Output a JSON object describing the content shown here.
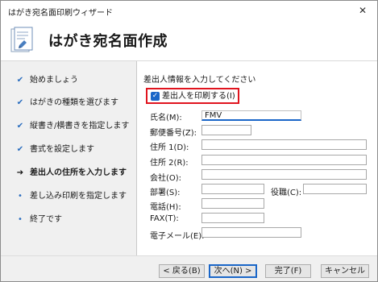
{
  "window": {
    "title": "はがき宛名面印刷ウィザード",
    "close_glyph": "✕"
  },
  "header": {
    "title": "はがき宛名面作成"
  },
  "steps": [
    {
      "label": "始めましょう",
      "mark": "✔",
      "state": "done"
    },
    {
      "label": "はがきの種類を選びます",
      "mark": "✔",
      "state": "done"
    },
    {
      "label": "縦書き/横書きを指定します",
      "mark": "✔",
      "state": "done"
    },
    {
      "label": "書式を設定します",
      "mark": "✔",
      "state": "done"
    },
    {
      "label": "差出人の住所を入力します",
      "mark": "➔",
      "state": "current"
    },
    {
      "label": "差し込み印刷を指定します",
      "mark": "•",
      "state": "pending"
    },
    {
      "label": "終了です",
      "mark": "•",
      "state": "pending"
    }
  ],
  "form": {
    "instruction": "差出人情報を入力してください",
    "print_sender_checkbox": {
      "label": "差出人を印刷する(I)",
      "checked": true,
      "check_glyph": "✓"
    },
    "fields": {
      "name": {
        "label": "氏名(M):",
        "value": "FMV"
      },
      "postal": {
        "label": "郵便番号(Z):",
        "value": ""
      },
      "address1": {
        "label": "住所 1(D):",
        "value": ""
      },
      "address2": {
        "label": "住所 2(R):",
        "value": ""
      },
      "company": {
        "label": "会社(O):",
        "value": ""
      },
      "department": {
        "label": "部署(S):",
        "value": ""
      },
      "position": {
        "label": "役職(C):",
        "value": ""
      },
      "phone": {
        "label": "電話(H):",
        "value": ""
      },
      "fax": {
        "label": "FAX(T):",
        "value": ""
      },
      "email": {
        "label": "電子メール(E):",
        "value": ""
      }
    }
  },
  "buttons": {
    "back": "< 戻る(B)",
    "next": "次へ(N) >",
    "finish": "完了(F)",
    "cancel": "キャンセル"
  },
  "colors": {
    "accent": "#1a66c8",
    "highlight_border": "#e0141e",
    "step_check": "#2a6dbf"
  }
}
